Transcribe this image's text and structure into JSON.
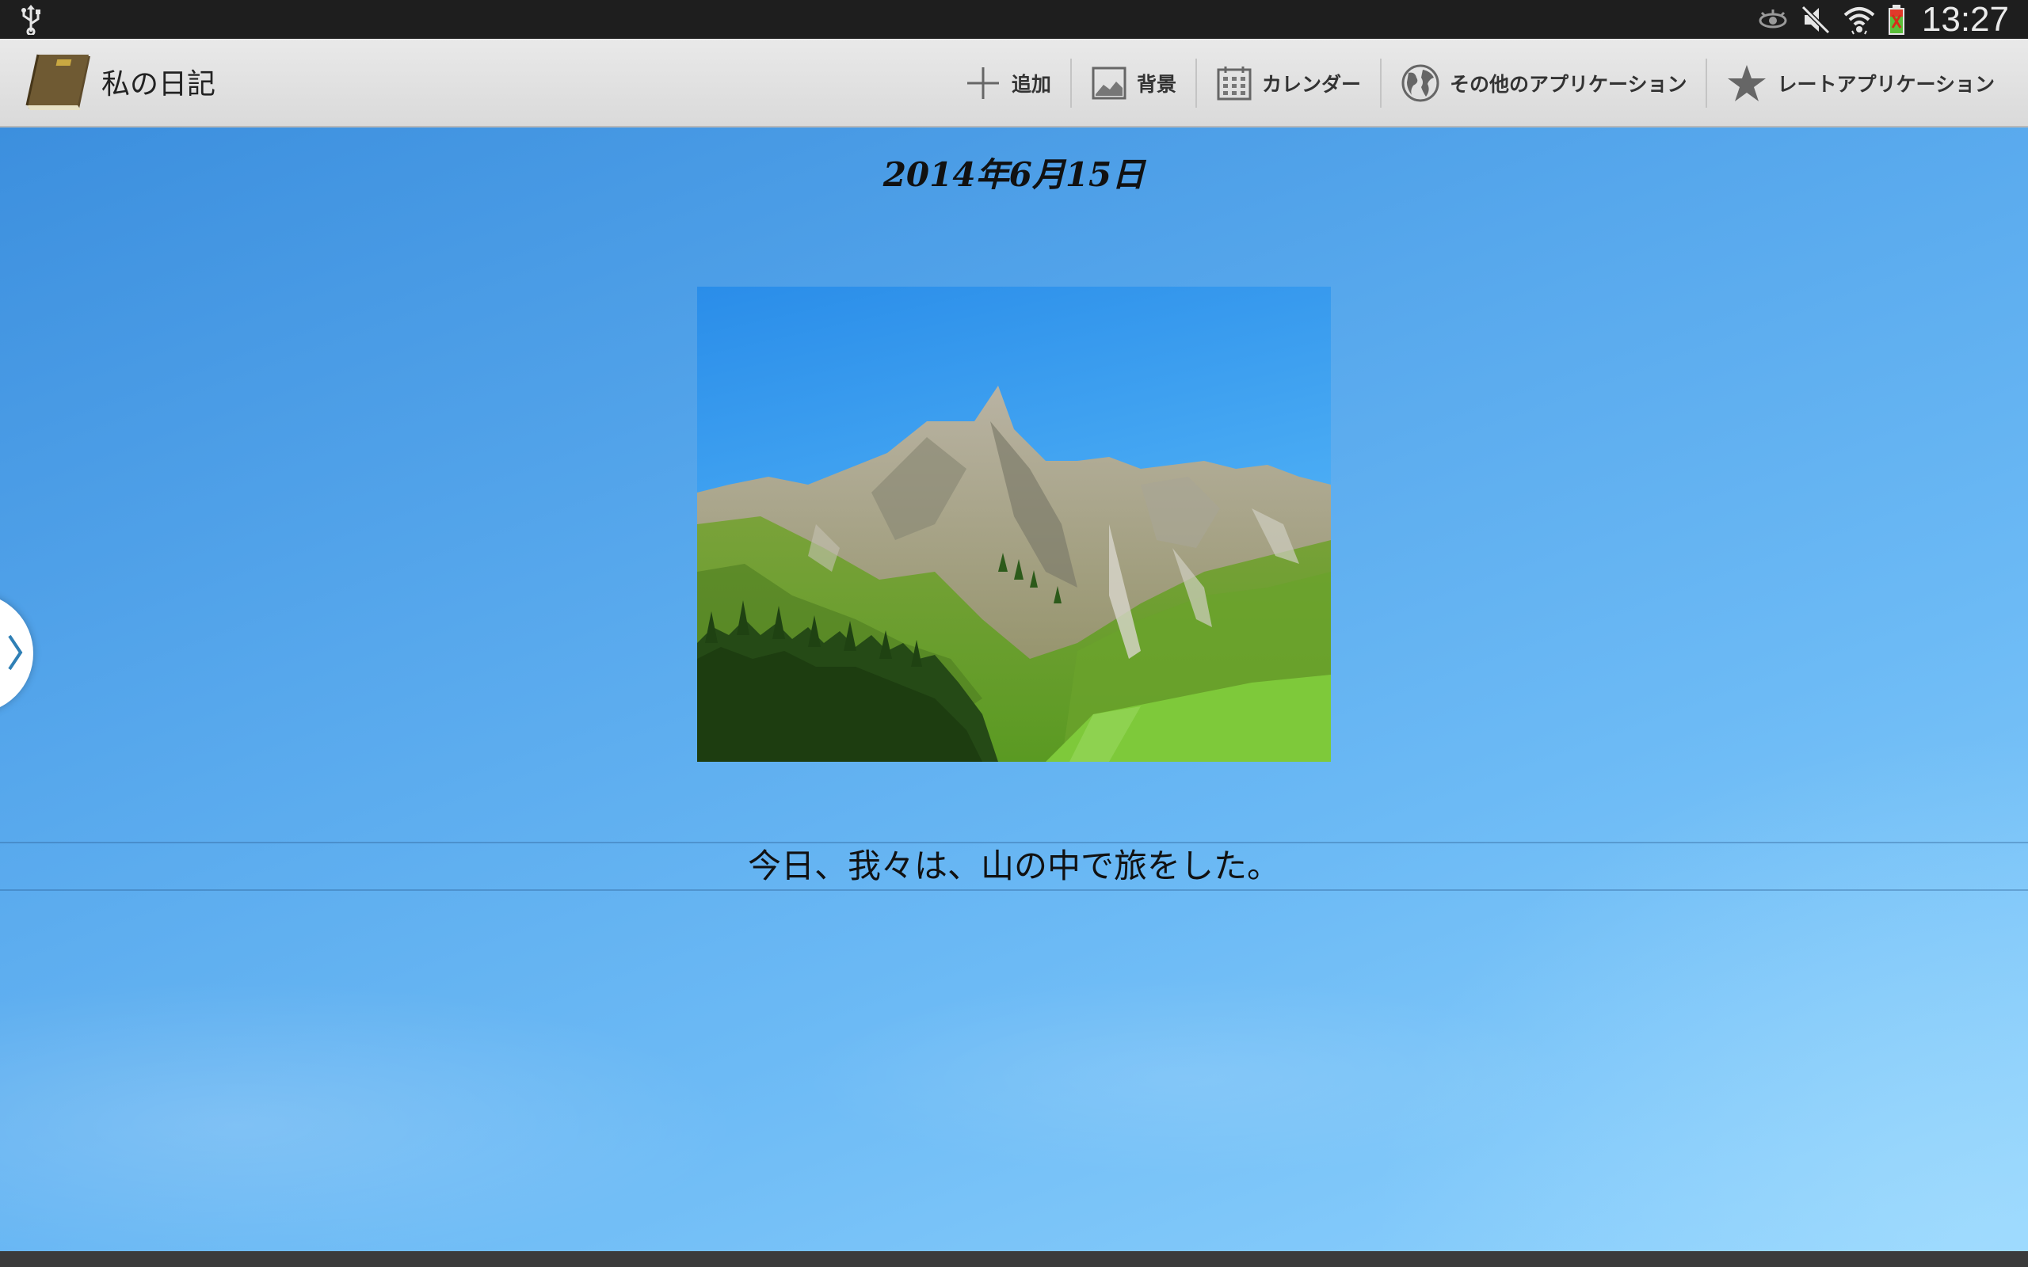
{
  "status_bar": {
    "time": "13:27",
    "icons": [
      "usb-icon",
      "eye-icon",
      "mute-icon",
      "wifi-icon",
      "battery-icon"
    ]
  },
  "action_bar": {
    "app_title": "私の日記",
    "actions": [
      {
        "label": "追加",
        "icon": "add-icon"
      },
      {
        "label": "背景",
        "icon": "image-icon"
      },
      {
        "label": "カレンダー",
        "icon": "calendar-icon"
      },
      {
        "label": "その他のアプリケーション",
        "icon": "globe-icon"
      },
      {
        "label": "レートアプリケーション",
        "icon": "star-icon"
      }
    ]
  },
  "entry": {
    "date": "2014年6月15日",
    "text": "今日、我々は、山の中で旅をした。"
  },
  "colors": {
    "sky_top": "#3c8fde",
    "sky_bottom": "#8fd2fd",
    "action_bar": "#e2e2e2",
    "status_bar": "#1e1e1e"
  }
}
